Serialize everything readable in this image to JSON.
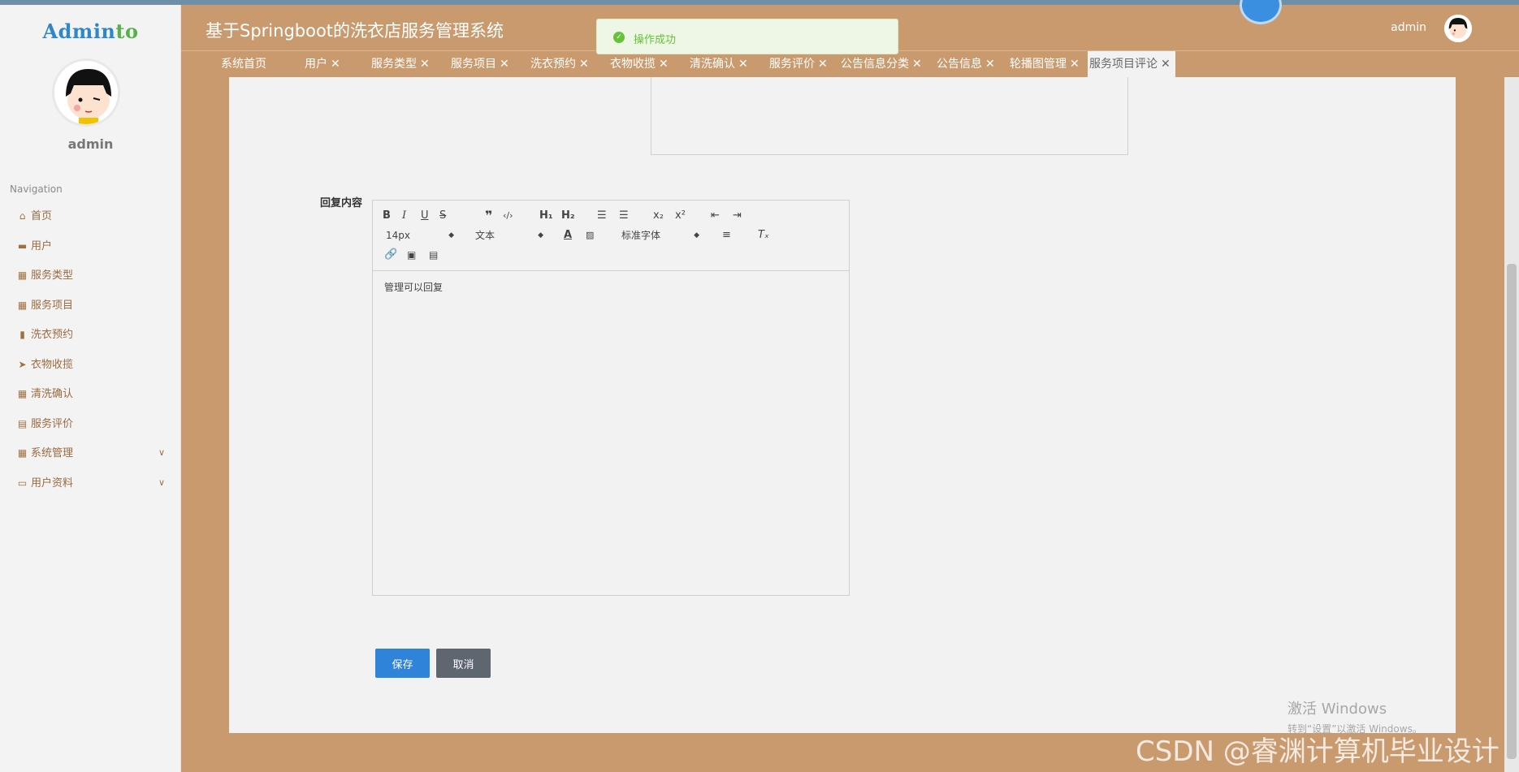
{
  "sidebar": {
    "logo_main": "Admin",
    "logo_accent": "to",
    "username": "admin",
    "nav_title": "Navigation",
    "items": [
      {
        "label": "首页",
        "icon": "home-icon"
      },
      {
        "label": "用户",
        "icon": "monitor-icon"
      },
      {
        "label": "服务类型",
        "icon": "grid-icon"
      },
      {
        "label": "服务项目",
        "icon": "grid-icon"
      },
      {
        "label": "洗衣预约",
        "icon": "book-icon"
      },
      {
        "label": "衣物收揽",
        "icon": "send-icon"
      },
      {
        "label": "清洗确认",
        "icon": "grid-icon"
      },
      {
        "label": "服务评价",
        "icon": "clipboard-icon"
      },
      {
        "label": "系统管理",
        "icon": "grid-icon",
        "expandable": true
      },
      {
        "label": "用户资料",
        "icon": "id-card-icon",
        "expandable": true
      }
    ]
  },
  "header": {
    "title": "基于Springboot的洗衣店服务管理系统",
    "user": "admin"
  },
  "tabs": [
    {
      "label": "系统首页",
      "closable": false
    },
    {
      "label": "用户",
      "closable": true
    },
    {
      "label": "服务类型",
      "closable": true
    },
    {
      "label": "服务项目",
      "closable": true
    },
    {
      "label": "洗衣预约",
      "closable": true
    },
    {
      "label": "衣物收揽",
      "closable": true
    },
    {
      "label": "清洗确认",
      "closable": true
    },
    {
      "label": "服务评价",
      "closable": true
    },
    {
      "label": "公告信息分类",
      "closable": true
    },
    {
      "label": "公告信息",
      "closable": true
    },
    {
      "label": "轮播图管理",
      "closable": true
    },
    {
      "label": "服务项目评论",
      "closable": true,
      "active": true
    }
  ],
  "toast": {
    "message": "操作成功"
  },
  "form": {
    "reply_label": "回复内容",
    "editor": {
      "font_size": "14px",
      "block_format": "文本",
      "font_family": "标准字体",
      "content": "管理可以回复"
    },
    "save_label": "保存",
    "cancel_label": "取消"
  },
  "watermarks": {
    "windows_title": "激活 Windows",
    "windows_sub": "转到“设置”以激活 Windows。",
    "csdn": "CSDN @睿渊计算机毕业设计"
  },
  "colors": {
    "brand": "#c99a6e",
    "primary_button": "#2f83d8",
    "secondary_button": "#5e6670",
    "success": "#67c23a"
  }
}
